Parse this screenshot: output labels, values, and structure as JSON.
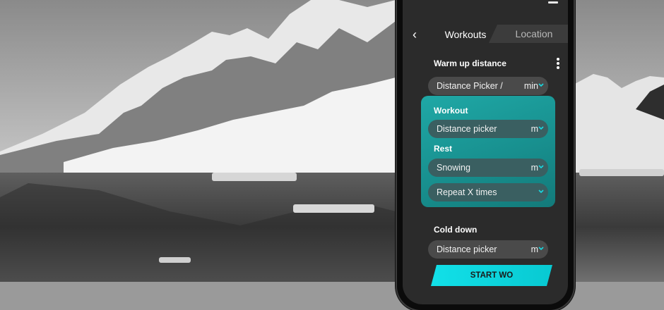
{
  "header": {
    "back_glyph": "‹",
    "tabs": [
      {
        "label": "Workouts",
        "active": true
      },
      {
        "label": "Location",
        "active": false
      }
    ]
  },
  "warmup": {
    "label": "Warm up distance",
    "picker_text": "Distance Picker /",
    "unit": "min"
  },
  "workout": {
    "label": "Workout",
    "picker_text": "Distance picker",
    "unit": "m"
  },
  "rest": {
    "label": "Rest",
    "picker_text": "Snowing",
    "unit": "m",
    "repeat_text": "Repeat X times"
  },
  "cooldown": {
    "label": "Cold down",
    "picker_text": "Distance picker",
    "unit": "m"
  },
  "start_button": "START WO",
  "colors": {
    "accent_cyan": "#12e0e8",
    "card_teal": "#1fa8a6",
    "screen_bg": "#2b2b2b"
  },
  "icons": [
    "back-chevron-icon",
    "kebab-menu-icon",
    "chevron-down-icon"
  ]
}
